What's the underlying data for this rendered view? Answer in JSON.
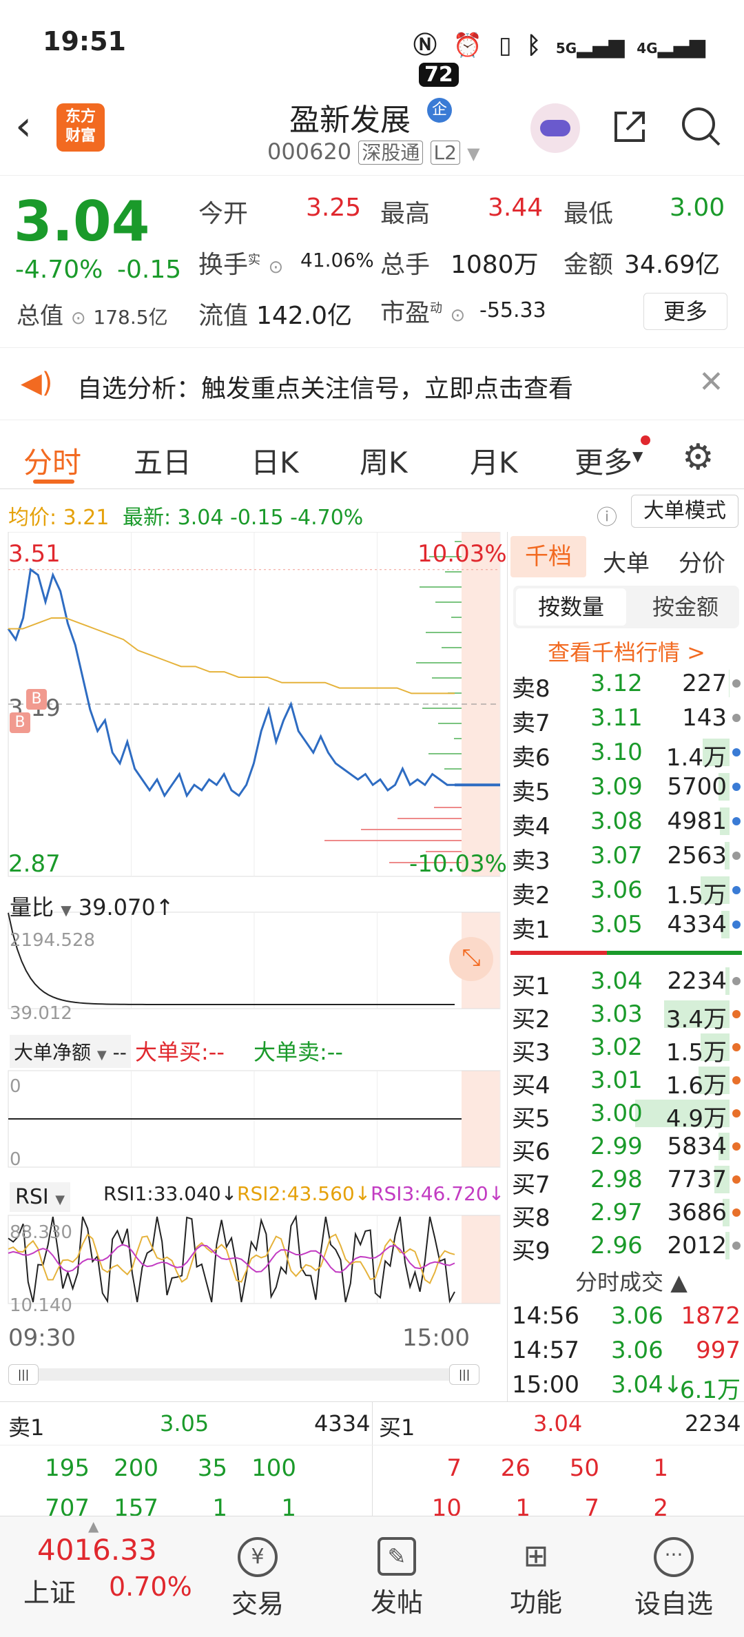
{
  "status": {
    "time": "19:51",
    "battery": "72",
    "net1": "5G",
    "net2": "4G"
  },
  "nav": {
    "title": "盈新发展",
    "badge": "企",
    "logo_line1": "东方",
    "logo_line2": "财富",
    "code": "000620",
    "exchange": "深股通",
    "level": "L2"
  },
  "quote": {
    "price": "3.04",
    "pct": "-4.70%",
    "chg": "-0.15",
    "open_label": "今开",
    "open": "3.25",
    "high_label": "最高",
    "high": "3.44",
    "low_label": "最低",
    "low": "3.00",
    "turnover_label": "换手",
    "turnover_sup": "实",
    "turnover": "41.06%",
    "vol_label": "总手",
    "vol": "1080万",
    "amt_label": "金额",
    "amt": "34.69亿",
    "mktcap_label": "总值",
    "mktcap": "178.5亿",
    "float_label": "流值",
    "float": "142.0亿",
    "pe_label": "市盈",
    "pe_sup": "动",
    "pe": "-55.33",
    "more": "更多"
  },
  "notice": {
    "text": "自选分析：触发重点关注信号，立即点击查看"
  },
  "tabs": [
    "分时",
    "五日",
    "日K",
    "周K",
    "月K",
    "更多"
  ],
  "avg": {
    "avg_label": "均价:",
    "avg": "3.21",
    "latest_label": "最新:",
    "latest": "3.04",
    "chg": "-0.15",
    "pct": "-4.70%",
    "mode": "大单模式"
  },
  "chart": {
    "top_price": "3.51",
    "mid_price": "3.19",
    "bottom_price": "2.87",
    "top_pct": "10.03%",
    "bottom_pct": "-10.03%",
    "marker_b": "B",
    "price_line": [
      3.33,
      3.31,
      3.35,
      3.44,
      3.43,
      3.38,
      3.43,
      3.4,
      3.34,
      3.3,
      3.24,
      3.18,
      3.14,
      3.16,
      3.1,
      3.08,
      3.12,
      3.07,
      3.05,
      3.03,
      3.05,
      3.02,
      3.04,
      3.06,
      3.02,
      3.04,
      3.03,
      3.05,
      3.04,
      3.06,
      3.03,
      3.02,
      3.04,
      3.08,
      3.14,
      3.18,
      3.12,
      3.16,
      3.19,
      3.14,
      3.12,
      3.1,
      3.13,
      3.1,
      3.08,
      3.07,
      3.06,
      3.05,
      3.06,
      3.04,
      3.05,
      3.03,
      3.04,
      3.07,
      3.04,
      3.05,
      3.04,
      3.06,
      3.05,
      3.04,
      3.04
    ],
    "avg_line": [
      3.33,
      3.33,
      3.34,
      3.35,
      3.35,
      3.34,
      3.33,
      3.32,
      3.31,
      3.29,
      3.28,
      3.27,
      3.26,
      3.26,
      3.25,
      3.25,
      3.24,
      3.24,
      3.24,
      3.23,
      3.23,
      3.23,
      3.23,
      3.22,
      3.22,
      3.22,
      3.22,
      3.22,
      3.21,
      3.21,
      3.21,
      3.21
    ],
    "vr_label": "量比",
    "vr": "39.070↑",
    "vr_top": "2194.528",
    "vr_bot": "39.012",
    "net_label": "大单净额",
    "net_val": "--",
    "big_buy": "大单买:--",
    "big_sell": "大单卖:--",
    "net_top": "0",
    "net_bot": "0",
    "rsi_label": "RSI",
    "rsi1": "RSI1:33.040↓",
    "rsi2": "RSI2:43.560↓",
    "rsi3": "RSI3:46.720↓",
    "rsi_top": "88.330",
    "rsi_bot": "10.140",
    "time_start": "09:30",
    "time_end": "15:00"
  },
  "book": {
    "tab1": "千档",
    "tab2": "大单",
    "tab3": "分价",
    "sub1": "按数量",
    "sub2": "按金额",
    "link": "查看千档行情 >",
    "sells": [
      {
        "l": "卖8",
        "p": "3.12",
        "v": "227",
        "c": "#999"
      },
      {
        "l": "卖7",
        "p": "3.11",
        "v": "143",
        "c": "#999"
      },
      {
        "l": "卖6",
        "p": "3.10",
        "v": "1.4万",
        "c": "#3a7bd5"
      },
      {
        "l": "卖5",
        "p": "3.09",
        "v": "5700",
        "c": "#3a7bd5"
      },
      {
        "l": "卖4",
        "p": "3.08",
        "v": "4981",
        "c": "#3a7bd5"
      },
      {
        "l": "卖3",
        "p": "3.07",
        "v": "2563",
        "c": "#999"
      },
      {
        "l": "卖2",
        "p": "3.06",
        "v": "1.5万",
        "c": "#3a7bd5"
      },
      {
        "l": "卖1",
        "p": "3.05",
        "v": "4334",
        "c": "#3a7bd5"
      }
    ],
    "buys": [
      {
        "l": "买1",
        "p": "3.04",
        "v": "2234",
        "c": "#999"
      },
      {
        "l": "买2",
        "p": "3.03",
        "v": "3.4万",
        "c": "#e8702a"
      },
      {
        "l": "买3",
        "p": "3.02",
        "v": "1.5万",
        "c": "#e8702a"
      },
      {
        "l": "买4",
        "p": "3.01",
        "v": "1.6万",
        "c": "#e8702a"
      },
      {
        "l": "买5",
        "p": "3.00",
        "v": "4.9万",
        "c": "#e8702a"
      },
      {
        "l": "买6",
        "p": "2.99",
        "v": "5834",
        "c": "#e8702a"
      },
      {
        "l": "买7",
        "p": "2.98",
        "v": "7737",
        "c": "#e8702a"
      },
      {
        "l": "买8",
        "p": "2.97",
        "v": "3686",
        "c": "#e8702a"
      },
      {
        "l": "买9",
        "p": "2.96",
        "v": "2012",
        "c": "#999"
      }
    ],
    "trades_title": "分时成交",
    "trades": [
      {
        "t": "14:56",
        "p": "3.06",
        "v": "1872"
      },
      {
        "t": "14:57",
        "p": "3.06",
        "v": "997"
      },
      {
        "t": "15:00",
        "p": "3.04↓",
        "v": "6.1万"
      }
    ]
  },
  "depth": {
    "sell_label": "卖1",
    "sell_price": "3.05",
    "sell_vol": "4334",
    "buy_label": "买1",
    "buy_price": "3.04",
    "buy_vol": "2234",
    "sell_r1": [
      "195",
      "200",
      "35",
      "100"
    ],
    "sell_r2": [
      "707",
      "157",
      "1",
      "1"
    ],
    "buy_r1": [
      "7",
      "26",
      "50",
      "1"
    ],
    "buy_r2": [
      "10",
      "1",
      "7",
      "2"
    ]
  },
  "bottom": {
    "index": "4016.33",
    "index_name": "上证",
    "index_pct": "0.70%",
    "items": [
      "交易",
      "发帖",
      "功能",
      "设自选"
    ],
    "trade_icon": "¥"
  }
}
